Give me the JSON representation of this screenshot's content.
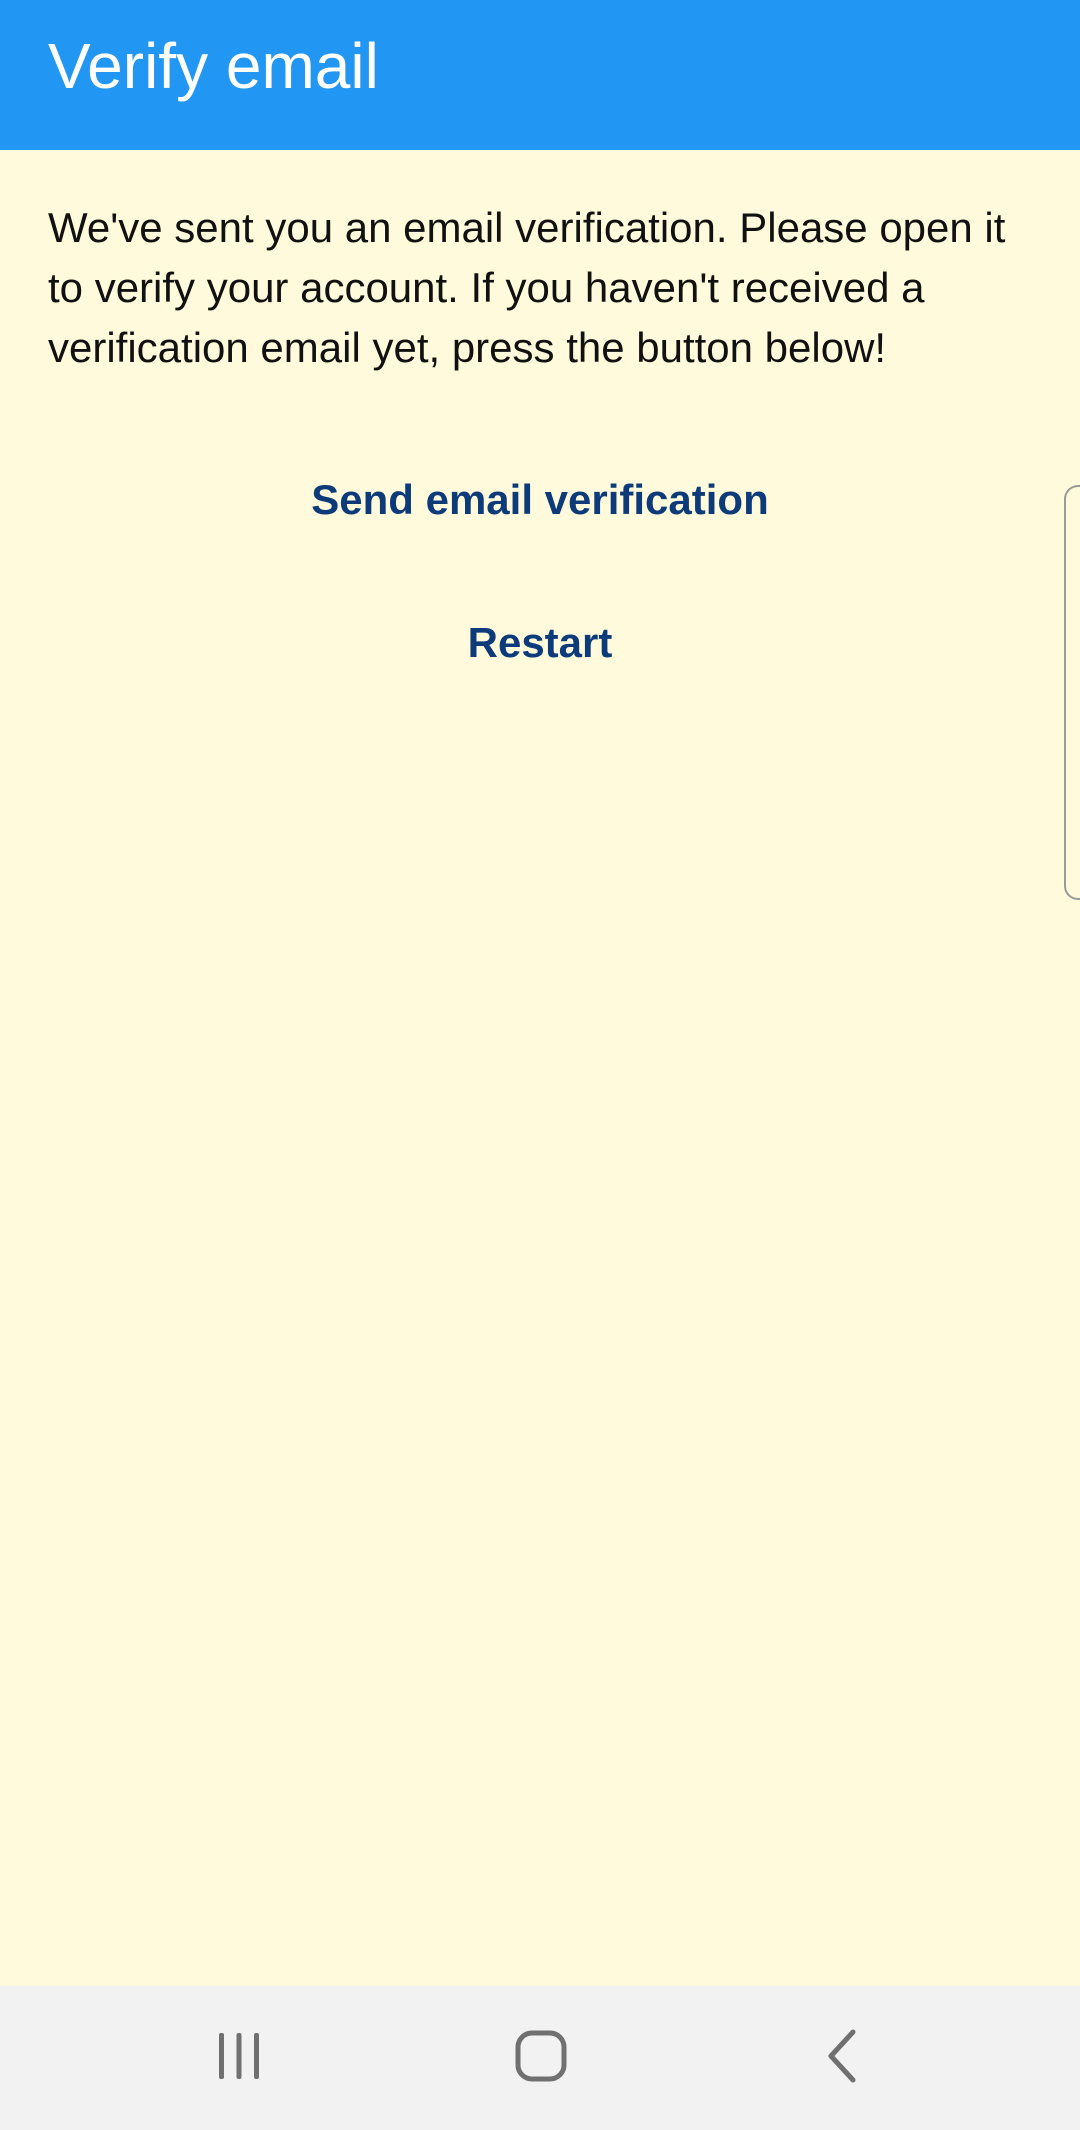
{
  "app_bar": {
    "title": "Verify email",
    "color": "#2196F3"
  },
  "main": {
    "background": "#FFFADC",
    "message": "We've sent you an email verification. Please open it to verify your account. If you haven't received a verification email yet, press the button below!",
    "send_button_label": "Send email verification",
    "restart_button_label": "Restart",
    "button_color": "#0D3B7A"
  },
  "nav_bar": {
    "recents_icon": "recents-icon",
    "home_icon": "home-icon",
    "back_icon": "back-icon"
  }
}
